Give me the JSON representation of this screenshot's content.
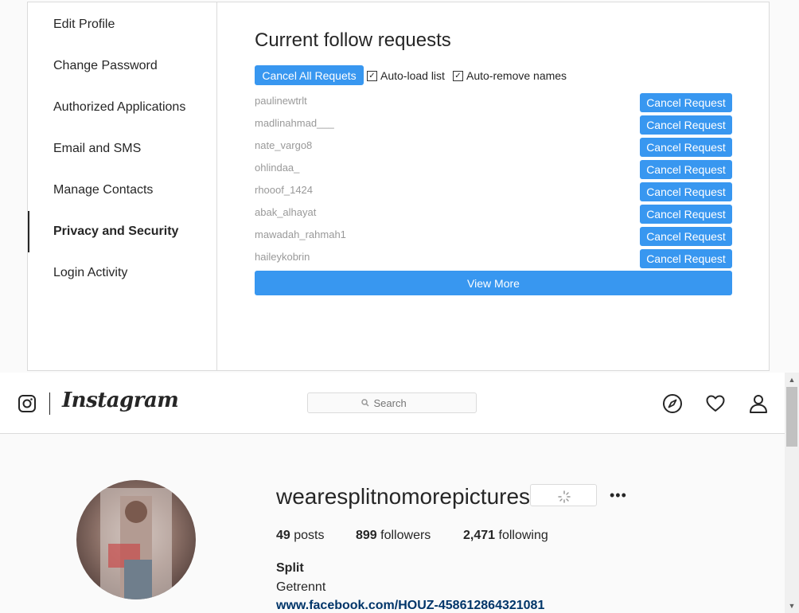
{
  "settings": {
    "sidebar": {
      "items": [
        {
          "label": "Edit Profile"
        },
        {
          "label": "Change Password"
        },
        {
          "label": "Authorized Applications"
        },
        {
          "label": "Email and SMS"
        },
        {
          "label": "Manage Contacts"
        },
        {
          "label": "Privacy and Security",
          "active": true
        },
        {
          "label": "Login Activity"
        }
      ]
    },
    "requests": {
      "title": "Current follow requests",
      "cancel_all_label": "Cancel All Requets",
      "auto_load_label": "Auto-load list",
      "auto_load_checked": true,
      "auto_remove_label": "Auto-remove names",
      "auto_remove_checked": true,
      "cancel_label": "Cancel Request",
      "view_more_label": "View More",
      "list": [
        {
          "username": "paulinewtrlt"
        },
        {
          "username": "madlinahmad___"
        },
        {
          "username": "nate_vargo8"
        },
        {
          "username": "ohlindaa_"
        },
        {
          "username": "rhooof_1424"
        },
        {
          "username": "abak_alhayat"
        },
        {
          "username": "mawadah_rahmah1"
        },
        {
          "username": "haileykobrin"
        }
      ]
    }
  },
  "header": {
    "logo_text": "Instagram",
    "search_placeholder": "Search",
    "icons": [
      "instagram-camera-icon",
      "compass-icon",
      "heart-icon",
      "user-icon"
    ]
  },
  "profile": {
    "username": "wearesplitnomorepictures",
    "posts_count": "49",
    "posts_label": "posts",
    "followers_count": "899",
    "followers_label": "followers",
    "following_count": "2,471",
    "following_label": "following",
    "full_name": "Split",
    "bio": "Getrennt",
    "website": "www.facebook.com/HOUZ-458612864321081"
  },
  "colors": {
    "accent": "#3897f0",
    "border": "#dbdbdb",
    "text": "#262626",
    "muted": "#999999",
    "link": "#003569"
  }
}
